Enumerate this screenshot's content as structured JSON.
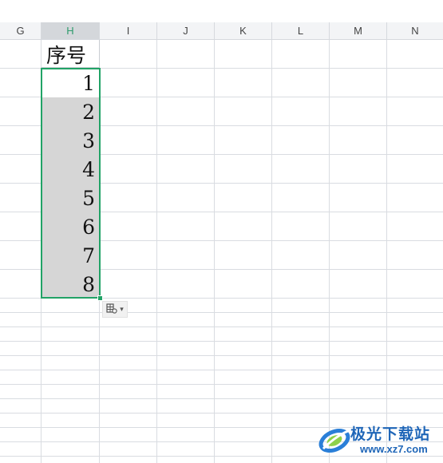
{
  "columns": [
    "G",
    "H",
    "I",
    "J",
    "K",
    "L",
    "M",
    "N"
  ],
  "active_column": "H",
  "header_cell": "序号",
  "numbers": [
    "1",
    "2",
    "3",
    "4",
    "5",
    "6",
    "7",
    "8"
  ],
  "paste_options": {
    "icon": "clipboard-table-icon",
    "arrow": "▾"
  },
  "watermark": {
    "title": "极光下载站",
    "url": "www.xz7.com"
  },
  "colors": {
    "selection": "#21a366",
    "filled_cell": "#d6d6d6",
    "active_header_text": "#2e9b6c"
  }
}
